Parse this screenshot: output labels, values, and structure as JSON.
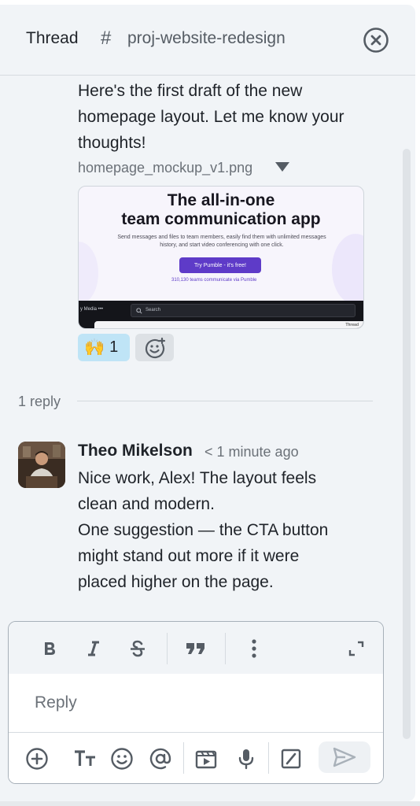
{
  "header": {
    "title": "Thread",
    "channel_hash": "#",
    "channel_name": "proj-website-redesign"
  },
  "message": {
    "text": "Here's the first draft of the new homepage layout. Let me know your thoughts!",
    "file_name": "homepage_mockup_v1.png",
    "preview": {
      "heading_line1": "The all-in-one",
      "heading_line2": "team communication app",
      "subtext": "Send messages and files to team members, easily find them with unlimited messages history, and start video conferencing with one click.",
      "cta": "Try Pumble - it's free!",
      "teams_note": "310,130 teams communicate via Pumble",
      "bar_label": "y Media  •••",
      "search_label": "Search",
      "inner_label": "Thread"
    },
    "reactions": [
      {
        "emoji": "🙌",
        "count": "1"
      }
    ]
  },
  "replies": {
    "label": "1 reply"
  },
  "reply": {
    "author": "Theo Mikelson",
    "time": "< 1 minute ago",
    "lines": [
      "Nice work, Alex! The layout feels",
      "clean and modern.",
      "One suggestion — the CTA button",
      "might stand out more if it were",
      "placed higher on the page."
    ]
  },
  "composer": {
    "placeholder": "Reply",
    "format_buttons": [
      "bold-icon",
      "italic-icon",
      "strikethrough-icon",
      "quote-icon",
      "more-vertical-icon",
      "expand-icon"
    ],
    "tool_buttons": [
      "add-icon",
      "text-format-icon",
      "emoji-icon",
      "mention-icon",
      "video-clip-icon",
      "microphone-icon",
      "slash-command-icon",
      "send-icon"
    ]
  },
  "colors": {
    "panel_bg": "#f1f4f7",
    "reaction_bg": "#bfe4f6",
    "brand_purple": "#5e3bc8"
  }
}
